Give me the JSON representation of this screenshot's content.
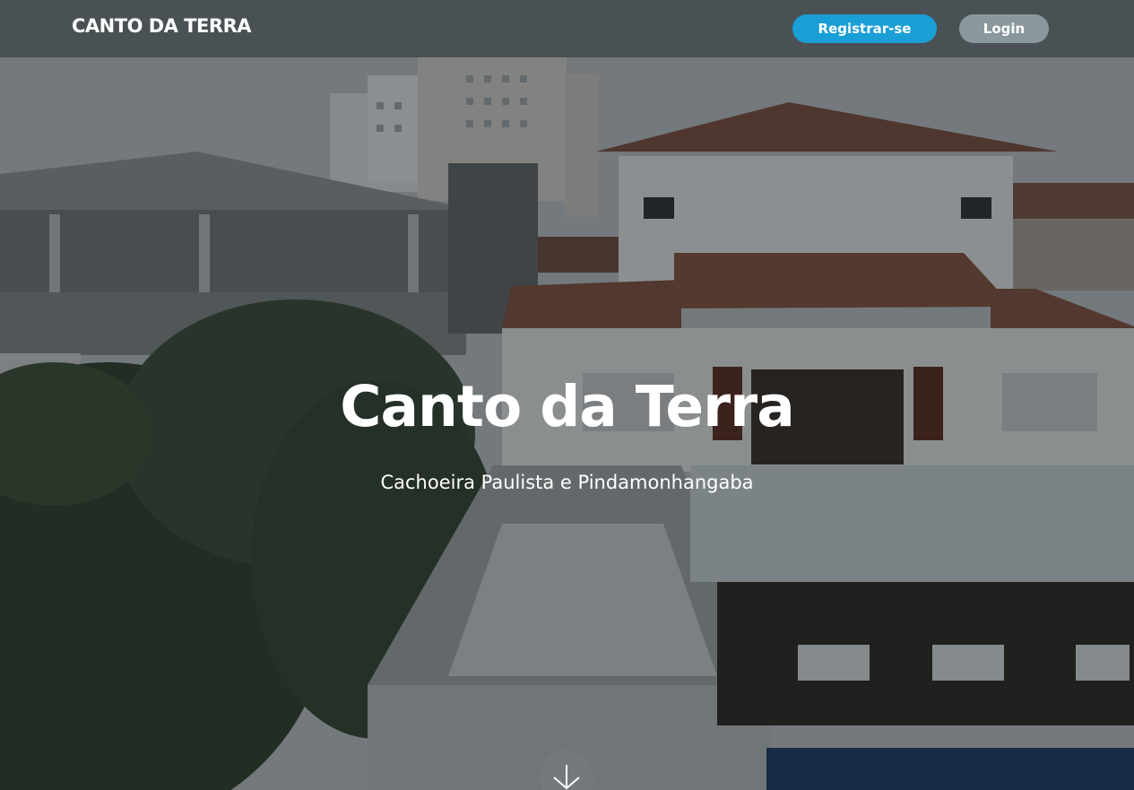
{
  "navbar": {
    "brand": "CANTO DA TERRA",
    "register_label": "Registrar-se",
    "login_label": "Login"
  },
  "hero": {
    "title": "Canto da Terra",
    "subtitle": "Cachoeira Paulista e Pindamonhangaba",
    "scroll_icon": "arrow-down-icon"
  },
  "colors": {
    "navbar_bg": "#4a5155",
    "register_button": "#1a9ed6",
    "login_button": "#8a979c"
  }
}
